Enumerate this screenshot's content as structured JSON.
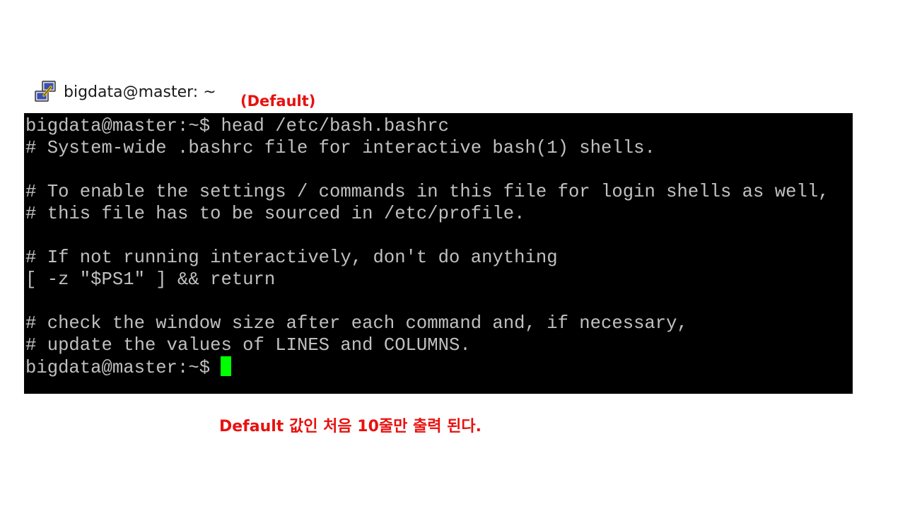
{
  "window": {
    "icon": "putty-icon",
    "title": "bigdata@master: ~"
  },
  "annotations": {
    "top": "(Default)",
    "bottom": "Default 값인 처음 10줄만 출력 된다.",
    "color": "#e8110f"
  },
  "terminal": {
    "background": "#000000",
    "text_color": "#c0c0c0",
    "cursor_color": "#00ff00",
    "lines": [
      "bigdata@master:~$ head /etc/bash.bashrc",
      "# System-wide .bashrc file for interactive bash(1) shells.",
      "",
      "# To enable the settings / commands in this file for login shells as well,",
      "# this file has to be sourced in /etc/profile.",
      "",
      "# If not running interactively, don't do anything",
      "[ -z \"$PS1\" ] && return",
      "",
      "# check the window size after each command and, if necessary,",
      "# update the values of LINES and COLUMNS."
    ],
    "prompt": "bigdata@master:~$ "
  }
}
